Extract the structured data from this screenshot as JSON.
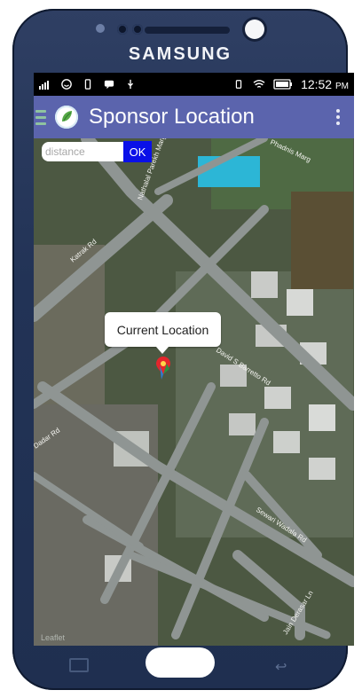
{
  "device": {
    "brand": "SAMSUNG"
  },
  "statusbar": {
    "time": "12:52",
    "ampm": "PM"
  },
  "appbar": {
    "title": "Sponsor Location"
  },
  "search": {
    "placeholder": "distance",
    "value": "",
    "ok_label": "OK"
  },
  "map": {
    "marker_label": "Current Location",
    "streets": [
      "Katrak Rd",
      "Nathalal Parekh Marg",
      "Phadnis Marg",
      "David S Barretto Rd",
      "Sewari Wadala Rd",
      "Jain Derasar Ln",
      "Dadar Rd"
    ],
    "watermark": "Leaflet"
  },
  "colors": {
    "appbar": "#5b64ad",
    "ok_button": "#0a10e8",
    "phone_frame": "#223356",
    "map_background": "#4a5540"
  }
}
